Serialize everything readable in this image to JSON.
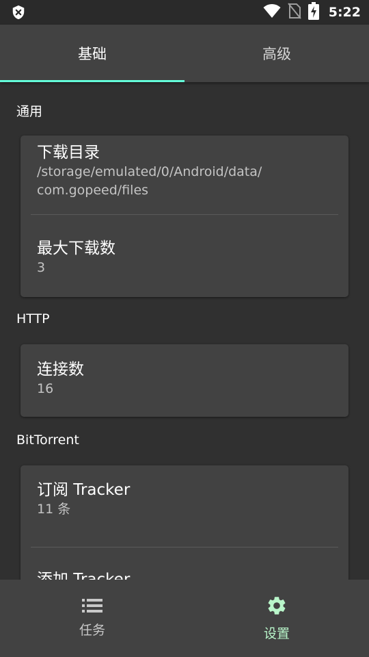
{
  "status_bar": {
    "time": "5:22",
    "icons": [
      "shield-x-icon",
      "wifi-icon",
      "no-sim-icon",
      "battery-charging-icon"
    ]
  },
  "tabs": [
    {
      "label": "基础",
      "active": true
    },
    {
      "label": "高级",
      "active": false
    }
  ],
  "sections": {
    "general": {
      "title": "通用",
      "items": [
        {
          "title": "下载目录",
          "value_line1": "/storage/emulated/0/Android/data/",
          "value_line2": "com.gopeed/files"
        },
        {
          "title": "最大下载数",
          "value": "3"
        }
      ]
    },
    "http": {
      "title": "HTTP",
      "items": [
        {
          "title": "连接数",
          "value": "16"
        }
      ]
    },
    "bittorrent": {
      "title": "BitTorrent",
      "items": [
        {
          "title": "订阅 Tracker",
          "value": "11 条"
        },
        {
          "title": "添加 Tracker"
        }
      ]
    }
  },
  "bottom_nav": [
    {
      "label": "任务",
      "icon": "list-icon",
      "active": false
    },
    {
      "label": "设置",
      "icon": "gear-icon",
      "active": true
    }
  ],
  "colors": {
    "accent_tab": "#64ffda",
    "accent_nav": "#b9f6ca",
    "background": "#303030",
    "card": "#424242"
  }
}
